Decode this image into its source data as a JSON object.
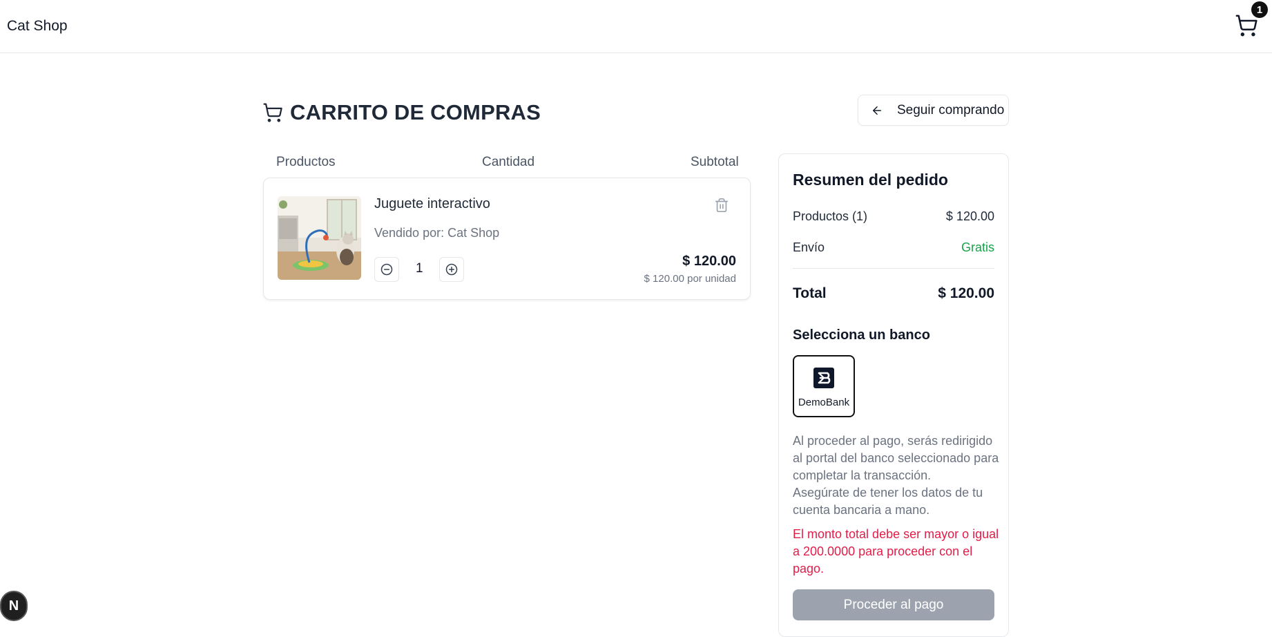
{
  "header": {
    "brand": "Cat Shop",
    "cart_count": "1"
  },
  "page": {
    "title": "CARRITO DE COMPRAS",
    "continue_label": "Seguir comprando"
  },
  "columns": {
    "products": "Productos",
    "quantity": "Cantidad",
    "subtotal": "Subtotal"
  },
  "cart_items": [
    {
      "name": "Juguete interactivo",
      "seller": "Vendido por: Cat Shop",
      "quantity": "1",
      "price": "$ 120.00",
      "unit_price": "$ 120.00 por unidad"
    }
  ],
  "summary": {
    "title": "Resumen del pedido",
    "products_label": "Productos (1)",
    "products_value": "$ 120.00",
    "shipping_label": "Envío",
    "shipping_value": "Gratis",
    "total_label": "Total",
    "total_value": "$ 120.00",
    "bank_title": "Selecciona un banco",
    "bank_name": "DemoBank",
    "info_line1": "Al proceder al pago, serás redirigido al portal del banco seleccionado para completar la transacción.",
    "info_line2": "Asegúrate de tener los datos de tu cuenta bancaria a mano.",
    "error": "El monto total debe ser mayor o igual a 200.0000 para proceder con el pago.",
    "pay_label": "Proceder al pago"
  },
  "devtools": {
    "badge_letter": "N"
  },
  "colors": {
    "shipping_free": "#16a34a",
    "error": "#e11d48",
    "disabled_button": "#9ca3af"
  }
}
